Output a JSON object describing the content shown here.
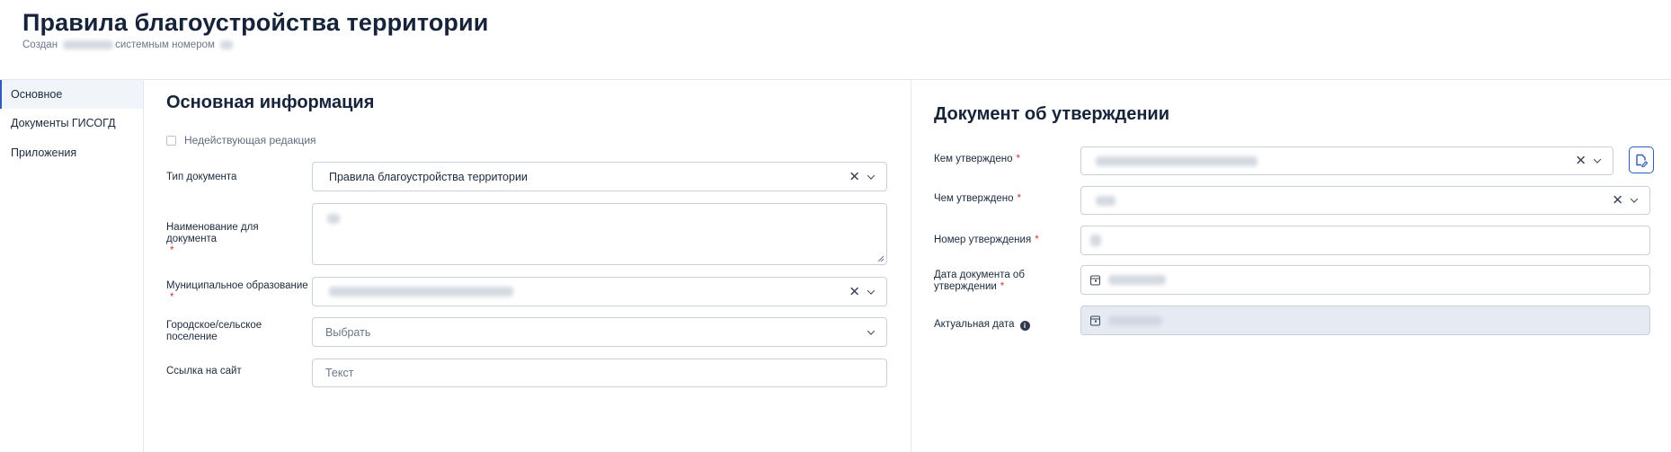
{
  "page": {
    "title": "Правила благоустройства территории",
    "created_label": "Создан",
    "system_number_label": "системным номером"
  },
  "sidebar": {
    "items": [
      {
        "label": "Основное",
        "active": true
      },
      {
        "label": "Документы ГИСОГД",
        "active": false
      },
      {
        "label": "Приложения",
        "active": false
      }
    ]
  },
  "basic_info": {
    "title": "Основная информация",
    "inactive_edition_label": "Недействующая редакция",
    "doc_type": {
      "label": "Тип документа",
      "value": "Правила благоустройства территории"
    },
    "doc_name": {
      "label": "Наименование для документа",
      "required_mark": "*"
    },
    "municipality": {
      "label": "Муниципальное образование",
      "required_mark": "*"
    },
    "settlement": {
      "label": "Городское/сельское поселение",
      "placeholder": "Выбрать"
    },
    "site_link": {
      "label": "Ссылка на сайт",
      "placeholder": "Текст"
    }
  },
  "approval_doc": {
    "title": "Документ об утверждении",
    "approved_by": {
      "label": "Кем утверждено",
      "required_mark": "*"
    },
    "approved_with": {
      "label": "Чем утверждено",
      "required_mark": "*"
    },
    "approval_number": {
      "label": "Номер утверждения",
      "required_mark": "*"
    },
    "approval_date": {
      "label": "Дата документа об утверждении",
      "required_mark": "*"
    },
    "actual_date": {
      "label": "Актуальная дата"
    }
  },
  "icons": {
    "clear": "close-icon",
    "dropdown": "chevron-down-icon",
    "calendar": "calendar-icon",
    "info": "info-icon",
    "document": "document-edit-icon"
  },
  "colors": {
    "accent": "#2f5bbf",
    "required": "#e0323a",
    "disabled_field": "#e6eaf2",
    "title": "#172339"
  }
}
